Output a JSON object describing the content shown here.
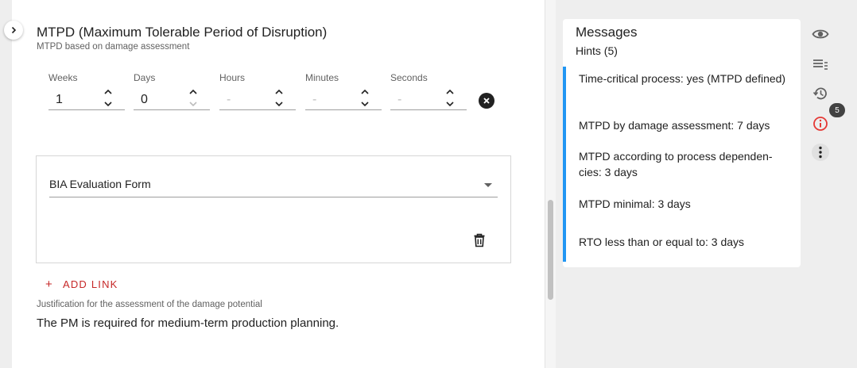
{
  "section": {
    "title": "MTPD (Maximum Tolerable Period of Disruption)",
    "subtitle": "MTPD based on damage assessment"
  },
  "duration": {
    "weeks": {
      "label": "Weeks",
      "value": "1"
    },
    "days": {
      "label": "Days",
      "value": "0"
    },
    "hours": {
      "label": "Hours",
      "placeholder": "-"
    },
    "minutes": {
      "label": "Minutes",
      "placeholder": "-"
    },
    "seconds": {
      "label": "Seconds",
      "placeholder": "-"
    }
  },
  "link": {
    "select_value": "BIA Evaluation Form",
    "add_label": "ADD LINK",
    "add_icon": "+"
  },
  "justification": {
    "label": "Justification for the assessment of the damage potential",
    "text": "The PM is required for medium-term production planning."
  },
  "messages": {
    "title": "Messages",
    "hints_title": "Hints (5)",
    "hints": [
      "Time-critical process: yes (MTPD defined)",
      "MTPD by damage assessment: 7 days",
      "MTPD according to process dependen-cies: 3 days",
      "MTPD minimal: 3 days",
      "RTO less than or equal to: 3 days"
    ]
  },
  "side_toolbar": {
    "badge_count": "5",
    "icons": [
      "eye-icon",
      "list-icon",
      "history-icon",
      "info-icon",
      "more-vert-icon"
    ]
  },
  "colors": {
    "accent_red": "#c62828",
    "hint_border_blue": "#2196f3",
    "panel_bg": "#ffffff",
    "app_bg": "#eeeeee"
  }
}
